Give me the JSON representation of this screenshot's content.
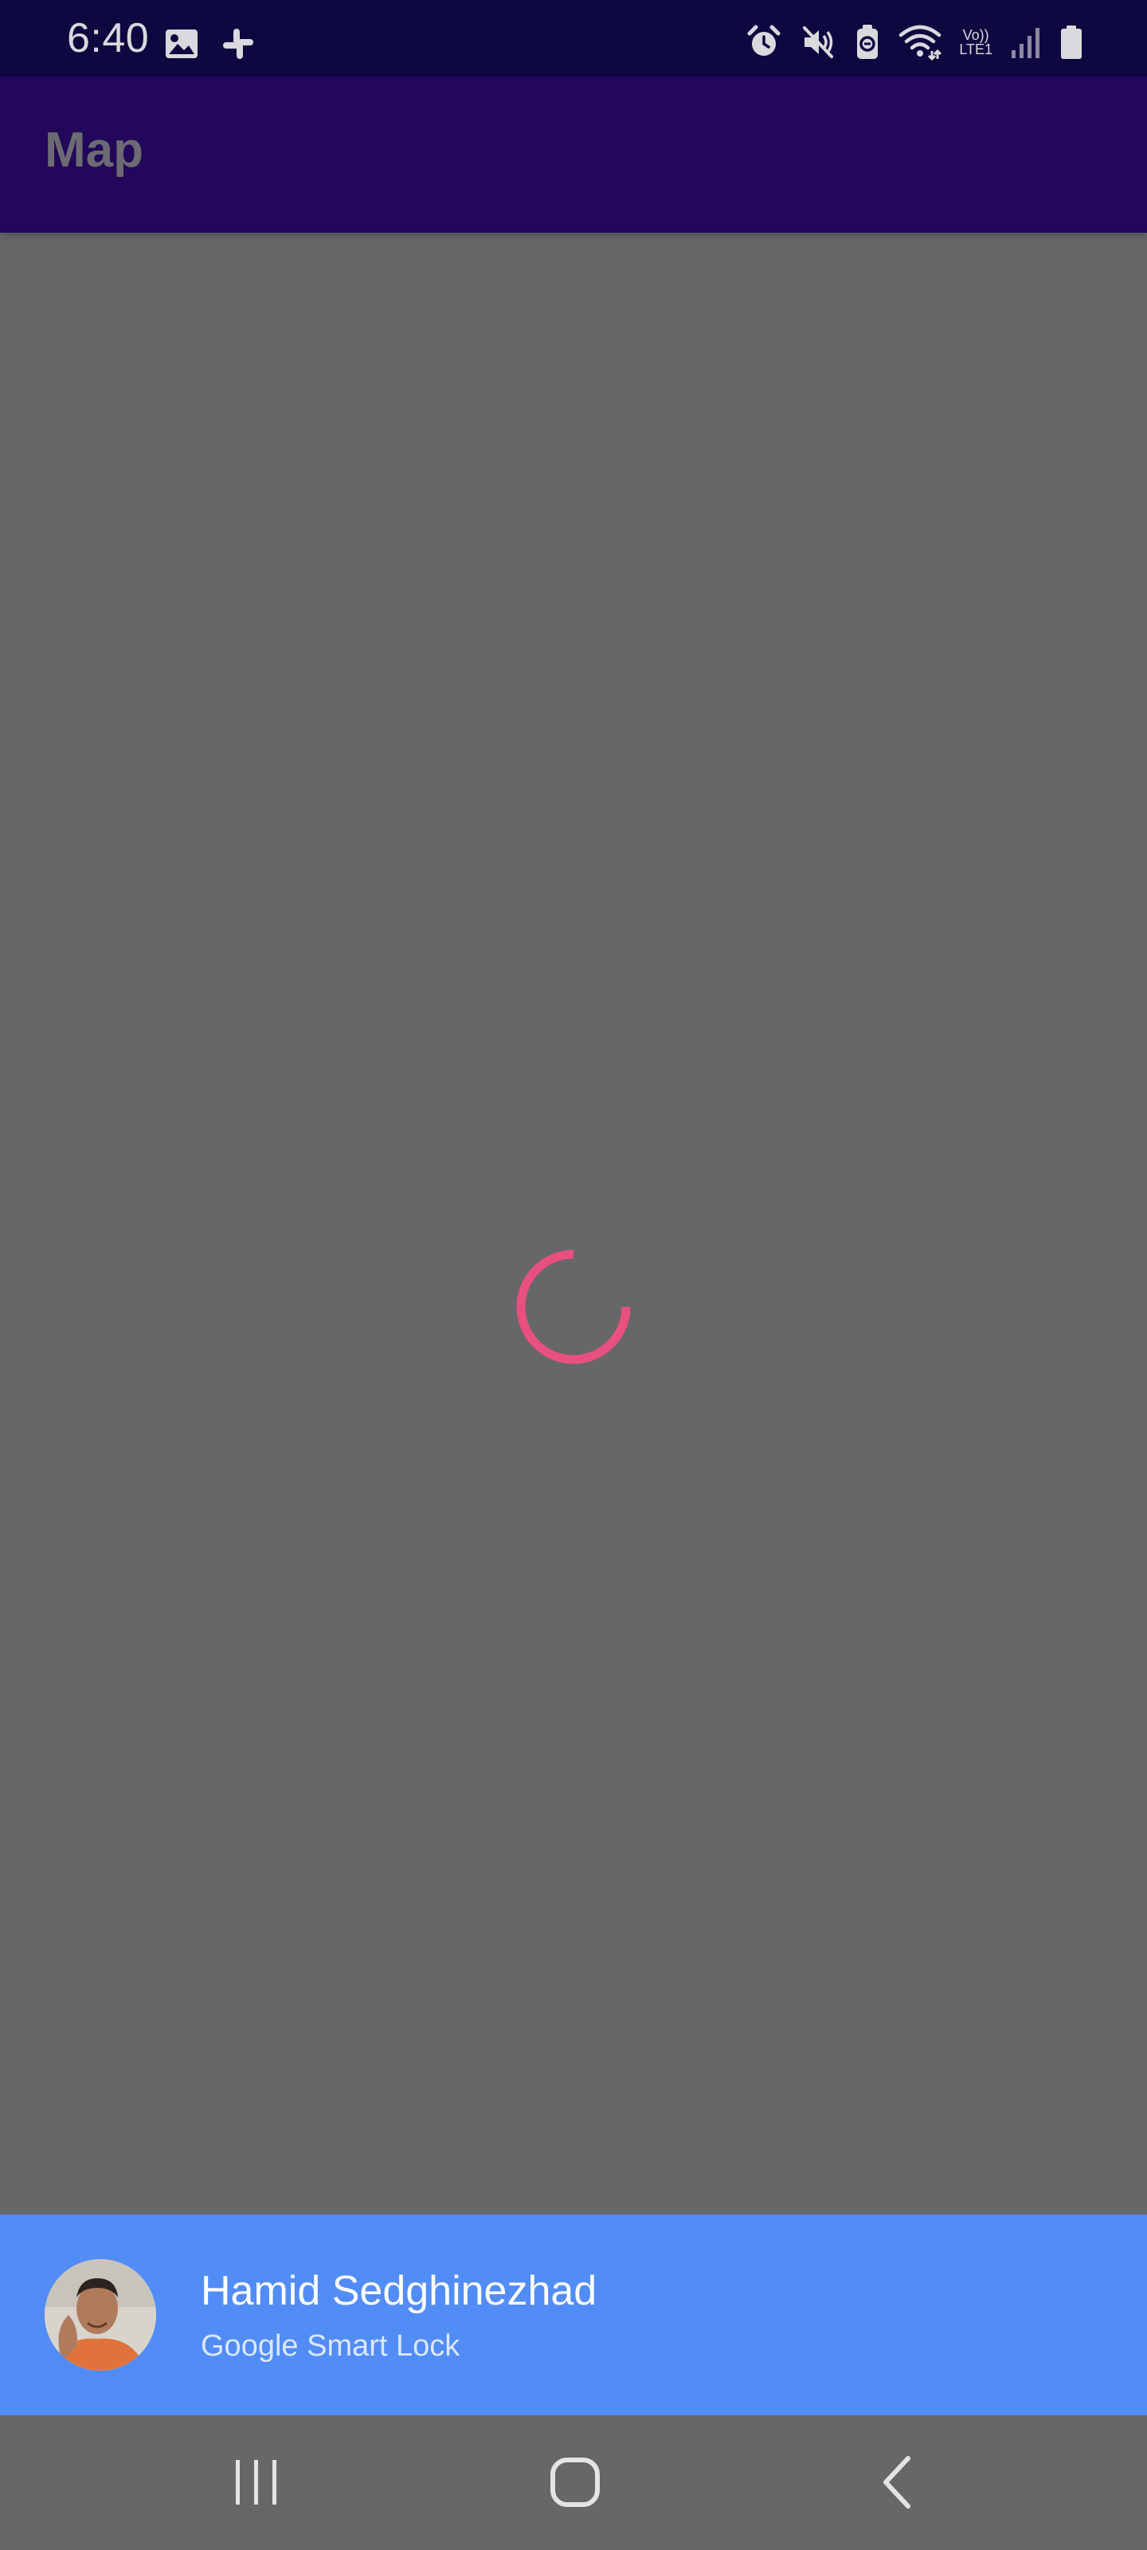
{
  "status_bar": {
    "time": "6:40",
    "network_label_top": "Vo))",
    "network_label_bottom": "LTE1",
    "left_icons": [
      "gallery-icon",
      "slack-icon"
    ],
    "right_icons": [
      "alarm-icon",
      "mute-icon",
      "battery-saver-icon",
      "wifi-icon",
      "volte-lte-icon",
      "signal-icon",
      "battery-icon"
    ]
  },
  "app_bar": {
    "title": "Map"
  },
  "loading": {
    "indicator": "spinner",
    "color": "#e8507f"
  },
  "smart_lock": {
    "account_name": "Hamid Sedghinezhad",
    "source": "Google Smart Lock",
    "background_color": "#528cf6"
  },
  "nav_bar": {
    "buttons": [
      "recent-apps-icon",
      "home-icon",
      "back-icon"
    ]
  },
  "colors": {
    "status_bar_bg": "#0e0840",
    "app_bar_bg": "#22075a",
    "content_bg": "#666768"
  }
}
